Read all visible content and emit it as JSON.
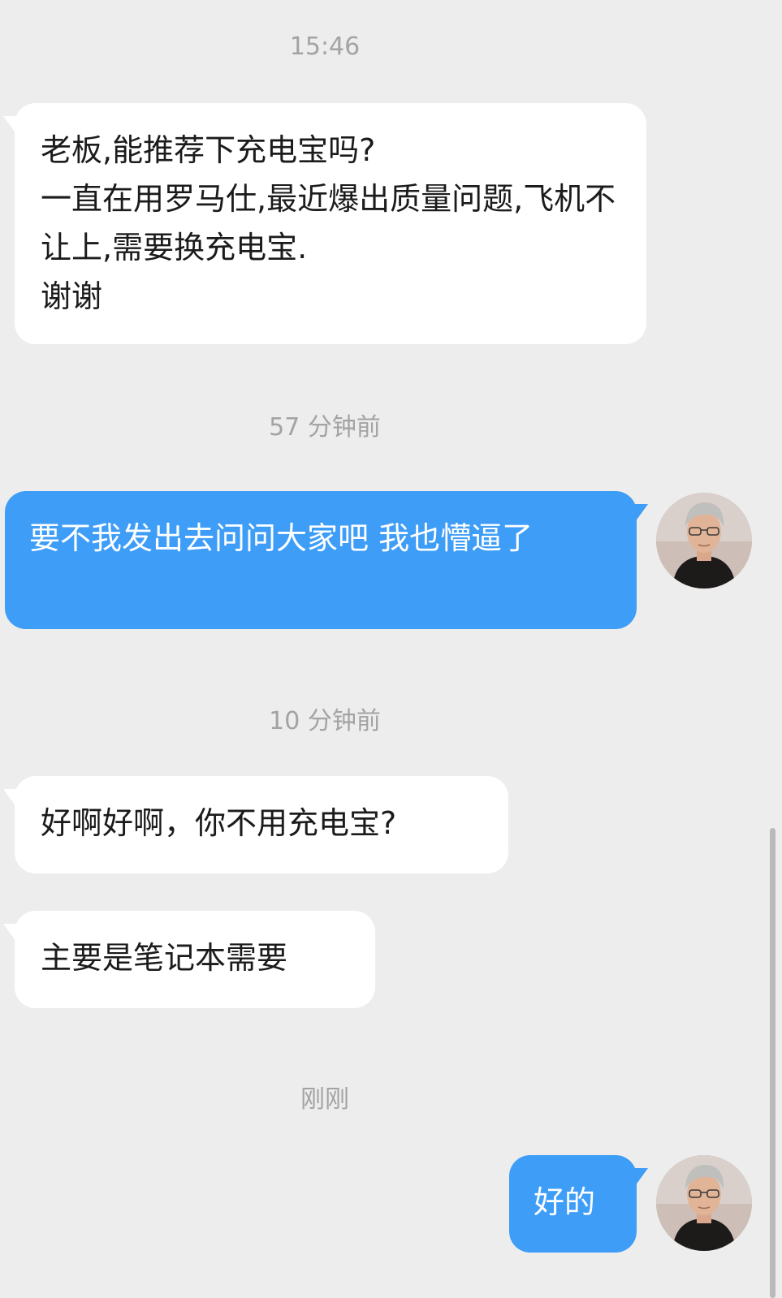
{
  "timestamps": {
    "t1": "15:46",
    "t2": "57 分钟前",
    "t3": "10 分钟前",
    "t4": "刚刚"
  },
  "messages": {
    "m1": "老板,能推荐下充电宝吗?\n一直在用罗马仕,最近爆出质量问题,飞机不让上,需要换充电宝.\n谢谢",
    "m2": "要不我发出去问问大家吧 我也懵逼了",
    "m3": "好啊好啊，你不用充电宝?",
    "m4": "主要是笔记本需要",
    "m5": "好的"
  },
  "colors": {
    "background": "#ededed",
    "incoming_bubble": "#ffffff",
    "outgoing_bubble": "#3e9df7",
    "timestamp_text": "#a3a3a3"
  }
}
